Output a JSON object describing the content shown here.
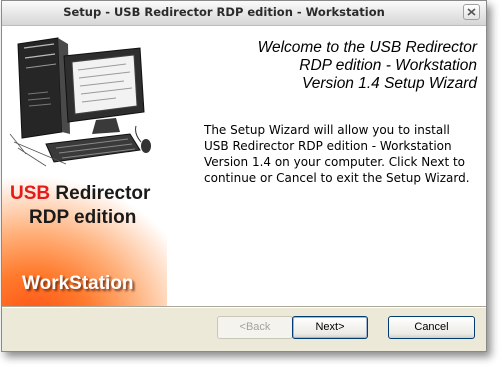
{
  "window": {
    "title": "Setup - USB Redirector RDP edition - Workstation"
  },
  "banner": {
    "brand_usb": "USB",
    "brand_redirector": " Redirector",
    "brand_line2": "RDP edition",
    "brand_edition": "WorkStation",
    "accent_color": "#e31b1b",
    "glow_color": "#ff5a1a"
  },
  "wizard": {
    "heading_line1": "Welcome to the USB Redirector",
    "heading_line2": "RDP edition - Workstation",
    "heading_line3": "Version 1.4 Setup Wizard",
    "description": "The Setup Wizard will allow you to install USB Redirector RDP edition - Workstation Version 1.4 on your computer. Click Next to continue or Cancel to exit the Setup Wizard."
  },
  "buttons": {
    "back_label": "<Back",
    "next_label": "Next>",
    "cancel_label": "Cancel"
  },
  "icons": {
    "close": "close-icon",
    "computer": "computer-illustration"
  }
}
